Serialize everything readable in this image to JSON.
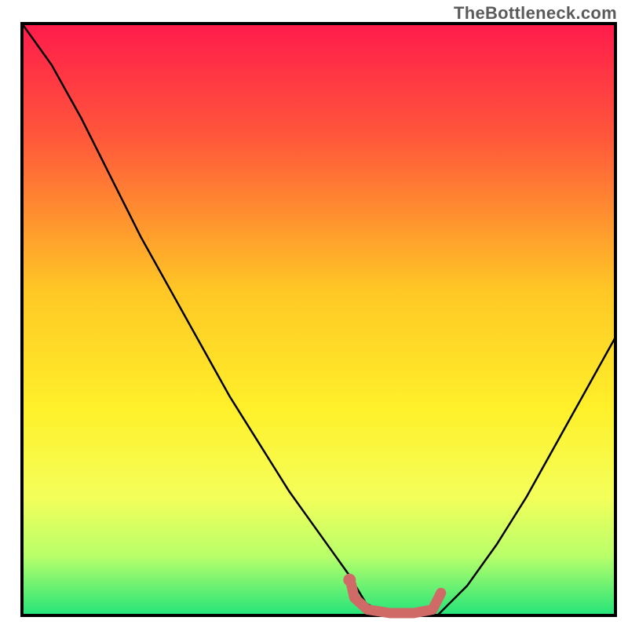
{
  "attribution": "TheBottleneck.com",
  "chart_data": {
    "type": "line",
    "title": "",
    "xlabel": "",
    "ylabel": "",
    "xlim": [
      0,
      1
    ],
    "ylim": [
      0,
      1
    ],
    "description": "Bottleneck curve over a red-to-green vertical gradient background. Y axis is bottleneck severity (1=worst/red at top, 0=none/green at bottom). X axis is a normalized hardware balance parameter. The curve descends steeply from top-left, reaches an optimal flat region near x≈0.58-0.70 at y≈0, then rises toward the right edge.",
    "gradient_stops": [
      {
        "pos": 0.0,
        "color": "#ff1b4b"
      },
      {
        "pos": 0.2,
        "color": "#ff5a3a"
      },
      {
        "pos": 0.45,
        "color": "#ffc725"
      },
      {
        "pos": 0.65,
        "color": "#fff02a"
      },
      {
        "pos": 0.8,
        "color": "#f4ff5a"
      },
      {
        "pos": 0.9,
        "color": "#b8ff6a"
      },
      {
        "pos": 1.0,
        "color": "#23e47a"
      }
    ],
    "series": [
      {
        "name": "bottleneck-curve",
        "x": [
          0.0,
          0.05,
          0.1,
          0.15,
          0.2,
          0.25,
          0.3,
          0.35,
          0.4,
          0.45,
          0.5,
          0.55,
          0.58,
          0.62,
          0.66,
          0.7,
          0.75,
          0.8,
          0.85,
          0.9,
          0.95,
          1.0
        ],
        "y": [
          1.0,
          0.93,
          0.84,
          0.74,
          0.64,
          0.55,
          0.46,
          0.37,
          0.29,
          0.21,
          0.14,
          0.07,
          0.02,
          0.0,
          0.0,
          0.0,
          0.05,
          0.12,
          0.2,
          0.29,
          0.38,
          0.47
        ]
      }
    ],
    "highlight": {
      "name": "optimal-region",
      "color": "#cf6a67",
      "points_xy": [
        [
          0.555,
          0.052
        ],
        [
          0.56,
          0.03
        ],
        [
          0.582,
          0.01
        ],
        [
          0.62,
          0.004
        ],
        [
          0.66,
          0.004
        ],
        [
          0.692,
          0.01
        ],
        [
          0.706,
          0.038
        ]
      ],
      "dot_xy": [
        0.552,
        0.06
      ]
    }
  }
}
